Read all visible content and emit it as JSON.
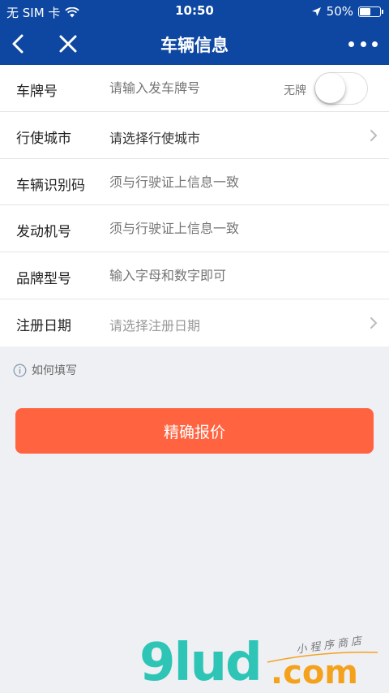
{
  "status_bar": {
    "carrier": "无 SIM 卡",
    "time": "10:50",
    "battery_percent": "50%",
    "battery_level": 0.5
  },
  "nav": {
    "title": "车辆信息"
  },
  "form": {
    "rows": [
      {
        "label": "车牌号",
        "placeholder": "请输入发车牌号",
        "toggle_label": "无牌",
        "toggle_on": false
      },
      {
        "label": "行使城市",
        "value": "请选择行使城市"
      },
      {
        "label": "车辆识别码",
        "placeholder": "须与行驶证上信息一致"
      },
      {
        "label": "发动机号",
        "placeholder": "须与行驶证上信息一致"
      },
      {
        "label": "品牌型号",
        "placeholder": "输入字母和数字即可"
      },
      {
        "label": "注册日期",
        "value": "请选择注册日期"
      }
    ]
  },
  "help": {
    "label": "如何填写"
  },
  "submit": {
    "label": "精确报价"
  },
  "watermark": {
    "brand": "9lud",
    "tld": ".com",
    "tagline": "小程序商店"
  },
  "colors": {
    "nav_bg": "#0d47a1",
    "button_bg": "#ff6340",
    "page_bg": "#eff0f4"
  }
}
